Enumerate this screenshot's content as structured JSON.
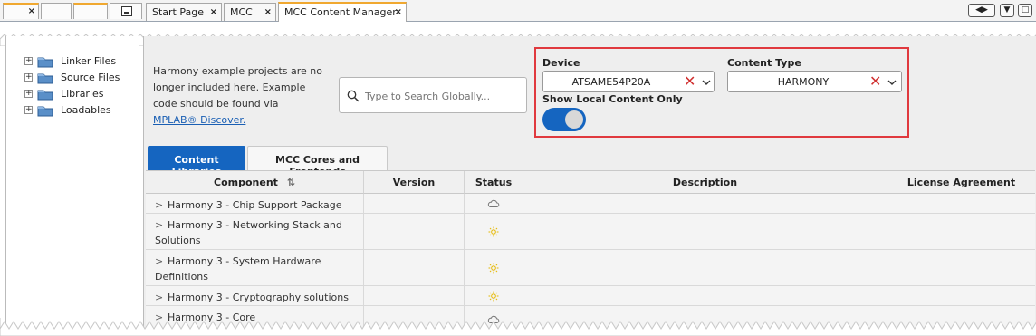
{
  "tabs": {
    "mini_close": "×",
    "documents": [
      {
        "label": "Start Page",
        "close": "×"
      },
      {
        "label": "MCC",
        "close": "×"
      },
      {
        "label": "MCC Content Manager",
        "close": "×"
      }
    ],
    "nav": {
      "prev": "◀",
      "next": "▶",
      "menu": "▼",
      "restore": "□"
    }
  },
  "tree": {
    "items": [
      {
        "label": "Linker Files",
        "expander": "+"
      },
      {
        "label": "Source Files",
        "expander": "+"
      },
      {
        "label": "Libraries",
        "expander": "+"
      },
      {
        "label": "Loadables",
        "expander": "+"
      }
    ]
  },
  "notice": {
    "text": "Harmony example projects are no longer included here. Example code should be found via ",
    "link": "MPLAB® Discover."
  },
  "search": {
    "placeholder": "Type to Search Globally..."
  },
  "filters": {
    "device_label": "Device",
    "device_value": "ATSAME54P20A",
    "content_type_label": "Content Type",
    "content_type_value": "HARMONY",
    "clear_glyph": "✕",
    "local_only_label": "Show Local Content Only",
    "local_only_on": true
  },
  "content_tabs": [
    "Content Libraries",
    "MCC Cores and Frontends"
  ],
  "table": {
    "columns": [
      "Component",
      "Version",
      "Status",
      "Description",
      "License Agreement"
    ],
    "sort_glyph": "⇅",
    "expand_glyph": ">",
    "rows": [
      {
        "component": "Harmony 3 - Chip Support Package",
        "status_icon": "cloud-icon"
      },
      {
        "component": "Harmony 3 - Networking Stack and Solutions",
        "status_icon": "sun-icon"
      },
      {
        "component": "Harmony 3 - System Hardware Definitions",
        "status_icon": "sun-icon"
      },
      {
        "component": "Harmony 3 - Cryptography solutions",
        "status_icon": "sun-icon"
      },
      {
        "component": "Harmony 3 - Core",
        "status_icon": "cloud-icon"
      }
    ]
  },
  "colors": {
    "accent": "#1565c0",
    "highlight_box": "#e0393e",
    "clear_x": "#d03030",
    "sun": "#e6b800"
  }
}
